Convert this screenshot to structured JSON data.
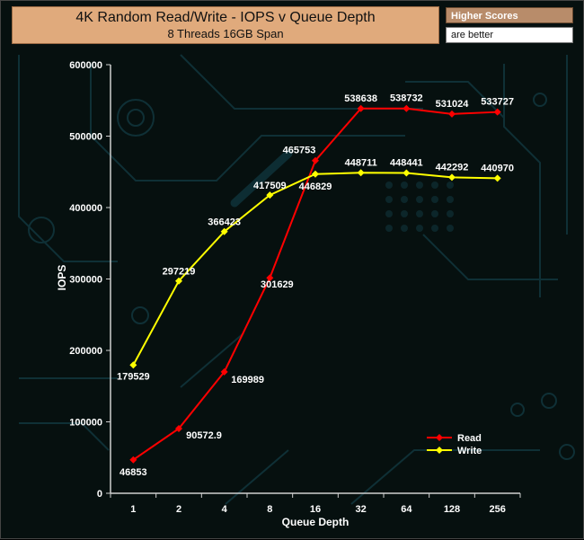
{
  "header": {
    "title": "4K Random Read/Write - IOPS v Queue Depth",
    "subtitle": "8 Threads 16GB Span"
  },
  "note": {
    "line1": "Higher Scores",
    "line2": "are better"
  },
  "colors": {
    "read": "#ff0000",
    "write": "#ffff00",
    "text": "#ffffff",
    "axis": "#cfcfcf",
    "title_bg": "#e0aa7c"
  },
  "chart_data": {
    "type": "line",
    "title": "4K Random Read/Write - IOPS v Queue Depth",
    "subtitle": "8 Threads 16GB Span",
    "xlabel": "Queue Depth",
    "ylabel": "IOPS",
    "x": [
      "1",
      "2",
      "4",
      "8",
      "16",
      "32",
      "64",
      "128",
      "256"
    ],
    "ylim": [
      0,
      600000
    ],
    "yticks": [
      "0",
      "100000",
      "200000",
      "300000",
      "400000",
      "500000",
      "600000"
    ],
    "grid": false,
    "legend": "lower-right",
    "series": [
      {
        "name": "Read",
        "color": "#ff0000",
        "values": [
          46853,
          90572.9,
          169989,
          301629,
          465753,
          538638,
          538732,
          531024,
          533727
        ],
        "labels": [
          "46853",
          "90572.9",
          "169989",
          "301629",
          "465753",
          "538638",
          "538732",
          "531024",
          "533727"
        ]
      },
      {
        "name": "Write",
        "color": "#ffff00",
        "values": [
          179529,
          297219,
          366423,
          417509,
          446829,
          448711,
          448441,
          442292,
          440970
        ],
        "labels": [
          "179529",
          "297219",
          "366423",
          "417509",
          "446829",
          "448711",
          "448441",
          "442292",
          "440970"
        ]
      }
    ]
  }
}
